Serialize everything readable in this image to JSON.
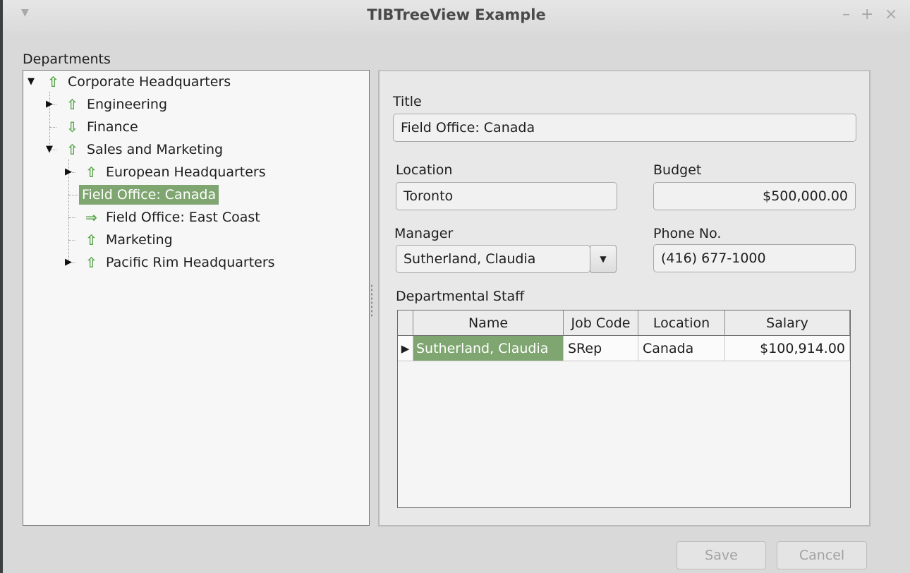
{
  "window": {
    "title": "TIBTreeView Example",
    "minimize_glyph": "–",
    "maximize_glyph": "+",
    "close_glyph": "×"
  },
  "tree": {
    "label": "Departments",
    "nodes": [
      {
        "label": "Corporate Headquarters",
        "icon": "arrow-up-icon"
      },
      {
        "label": "Engineering",
        "icon": "arrow-up-icon"
      },
      {
        "label": "Finance",
        "icon": "arrow-down-icon"
      },
      {
        "label": "Sales and Marketing",
        "icon": "arrow-up-icon"
      },
      {
        "label": "European Headquarters",
        "icon": "arrow-up-icon"
      },
      {
        "label": "Field Office: Canada",
        "selected": true
      },
      {
        "label": "Field Office: East Coast",
        "icon": "arrow-right-icon"
      },
      {
        "label": "Marketing",
        "icon": "arrow-up-icon"
      },
      {
        "label": "Pacific Rim Headquarters",
        "icon": "arrow-up-icon"
      }
    ]
  },
  "detail": {
    "title_label": "Title",
    "title_value": "Field Office: Canada",
    "location_label": "Location",
    "location_value": "Toronto",
    "budget_label": "Budget",
    "budget_value": "$500,000.00",
    "manager_label": "Manager",
    "manager_value": "Sutherland, Claudia",
    "phone_label": "Phone No.",
    "phone_value": "(416) 677-1000",
    "staff_label": "Departmental Staff"
  },
  "staff_grid": {
    "columns": [
      "Name",
      "Job Code",
      "Location",
      "Salary"
    ],
    "rows": [
      {
        "name": "Sutherland, Claudia",
        "job_code": "SRep",
        "location": "Canada",
        "salary": "$100,914.00"
      }
    ]
  },
  "buttons": {
    "save": "Save",
    "cancel": "Cancel"
  },
  "colors": {
    "selection": "#7fa670",
    "icon_green": "#5aa64c"
  }
}
